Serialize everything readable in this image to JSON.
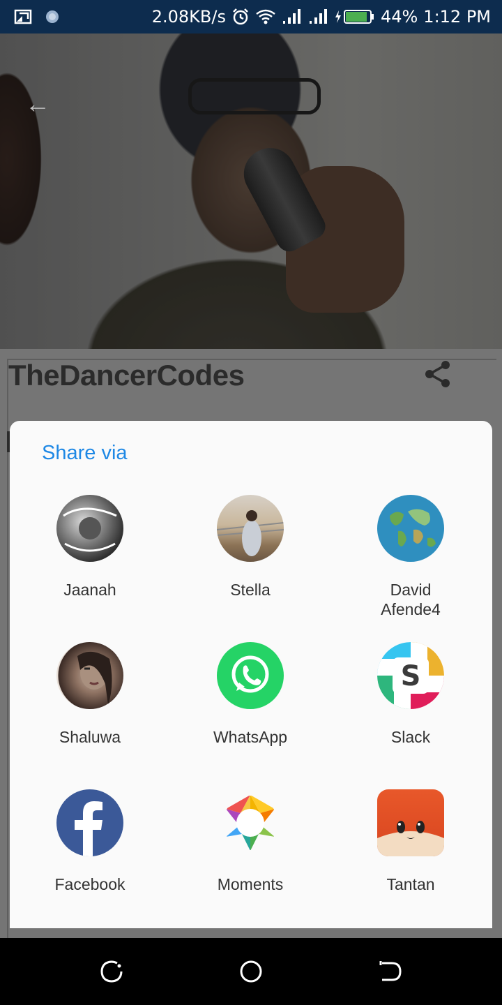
{
  "status_bar": {
    "network_speed": "2.08KB/s",
    "battery": "44%",
    "time": "1:12 PM"
  },
  "page": {
    "title": "TheDancerCodes"
  },
  "share_sheet": {
    "title": "Share via",
    "targets": [
      {
        "label": "Jaanah"
      },
      {
        "label": "Stella"
      },
      {
        "label": "David Afende4"
      },
      {
        "label": "Shaluwa"
      },
      {
        "label": "WhatsApp"
      },
      {
        "label": "Slack"
      },
      {
        "label": "Facebook"
      },
      {
        "label": "Moments"
      },
      {
        "label": "Tantan"
      }
    ]
  },
  "colors": {
    "status_bar_bg": "#0d2c4e",
    "accent": "#1e88e5",
    "whatsapp": "#25d366",
    "facebook": "#3b5998",
    "tantan": "#e8582a"
  },
  "icons": {
    "cast": "cast-icon",
    "alarm": "alarm-icon",
    "wifi": "wifi-icon",
    "signal": "signal-icon",
    "battery": "battery-icon",
    "share": "share-icon",
    "recents": "recents-icon",
    "home": "home-icon",
    "back": "back-icon"
  }
}
